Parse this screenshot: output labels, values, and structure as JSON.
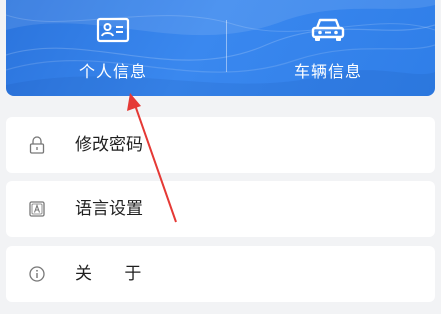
{
  "banner": {
    "personal_info_label": "个人信息",
    "vehicle_info_label": "车辆信息",
    "personal_info_icon": "id-card-icon",
    "vehicle_info_icon": "car-icon",
    "color": "#2f7ee8"
  },
  "menu": {
    "items": [
      {
        "label": "修改密码",
        "icon": "lock-icon"
      },
      {
        "label": "语言设置",
        "icon": "language-icon"
      },
      {
        "label": "关      于",
        "icon": "info-icon"
      }
    ]
  },
  "annotation": {
    "color": "#e53935"
  }
}
